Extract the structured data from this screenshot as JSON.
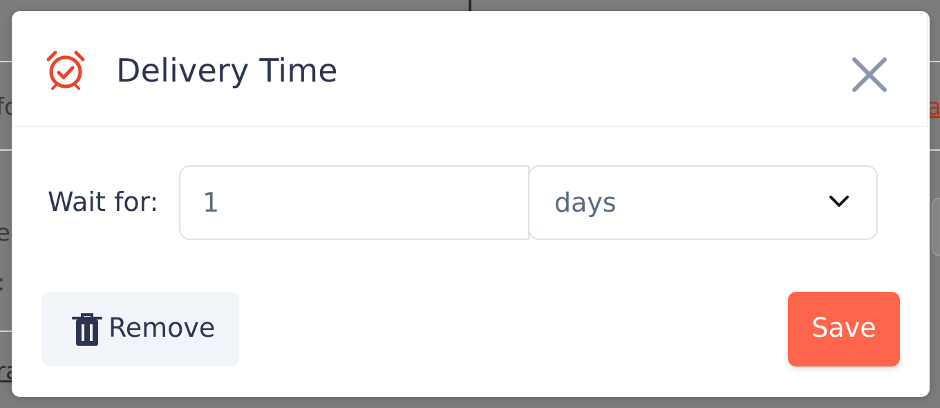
{
  "background": {
    "fragments": [
      "fo",
      "ar",
      "ec",
      ":",
      "ra"
    ]
  },
  "modal": {
    "title": "Delivery Time",
    "title_icon": "alarm-clock-check-icon",
    "close_icon": "close-icon",
    "wait_label": "Wait for:",
    "amount_value": "1",
    "unit_value": "days",
    "unit_icon": "chevron-down-icon",
    "remove_label": "Remove",
    "remove_icon": "trash-icon",
    "save_label": "Save"
  },
  "colors": {
    "accent": "#ff654a",
    "icon_red": "#e8452c",
    "title_text": "#2b3550",
    "close_icon": "#8a97ad",
    "border": "#dbe3ec",
    "remove_bg": "#f1f4f9"
  }
}
